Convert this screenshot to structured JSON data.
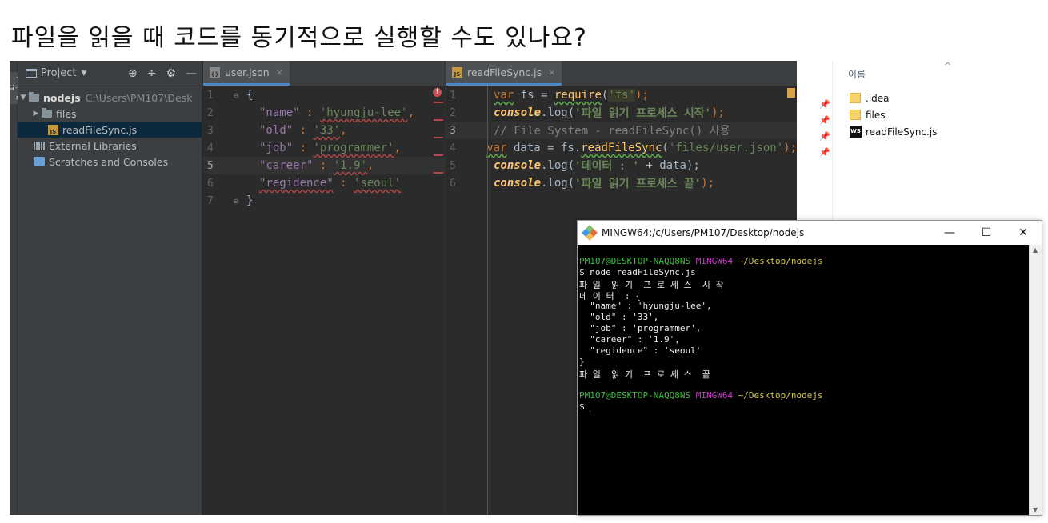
{
  "slide": {
    "title": "파일을 읽을 때 코드를 동기적으로 실행할 수도 있나요?"
  },
  "ide": {
    "stripe_label": "1: Project",
    "project_panel": {
      "header": "Project",
      "tree": [
        {
          "label": "nodejs",
          "path": "C:\\Users\\PM107\\Desk"
        },
        {
          "label": "files"
        },
        {
          "label": "readFileSync.js"
        },
        {
          "label": "External Libraries"
        },
        {
          "label": "Scratches and Consoles"
        }
      ]
    },
    "tabs": {
      "left": "user.json",
      "right": "readFileSync.js",
      "close": "×"
    },
    "json_lines": [
      [
        "1",
        "{"
      ],
      [
        "2",
        "\"name\"",
        " : ",
        "'hyungju-lee'",
        ","
      ],
      [
        "3",
        "\"old\"",
        " : ",
        "'33'",
        ","
      ],
      [
        "4",
        "\"job\"",
        " : ",
        "'programmer'",
        ","
      ],
      [
        "5",
        "\"career\"",
        " : ",
        "'1.9'",
        ","
      ],
      [
        "6",
        "\"regidence\"",
        " : ",
        "'seoul'",
        ""
      ],
      [
        "7",
        "}"
      ]
    ],
    "js_lines": {
      "l1": [
        "1",
        "var",
        " fs = ",
        "require",
        "(",
        "'fs'",
        ");"
      ],
      "l2": [
        "2",
        "console",
        ".log(",
        "'파일 읽기 프로세스 시작'",
        ");"
      ],
      "l3": [
        "3",
        "// File System - readFileSync() 사용"
      ],
      "l4": [
        "4",
        "var",
        " data = fs.",
        "readFileSync",
        "(",
        "'files/user.json'",
        ");"
      ],
      "l5": [
        "5",
        "console",
        ".log(",
        "'데이터 : '",
        " + data);"
      ],
      "l6": [
        "6",
        "console",
        ".log(",
        "'파일 읽기 프로세스 끝'",
        ");"
      ]
    }
  },
  "explorer": {
    "column_header": "이름",
    "items": [
      ".idea",
      "files",
      "readFileSync.js"
    ]
  },
  "terminal": {
    "title": "MINGW64:/c/Users/PM107/Desktop/nodejs",
    "controls": {
      "minimize": "—",
      "maximize": "☐",
      "close": "✕"
    },
    "prompt": {
      "user": "PM107@DESKTOP-NAQQ8NS",
      "env": "MINGW64",
      "dir": "~/Desktop/nodejs"
    },
    "command": "$ node readFileSync.js",
    "output": [
      "파 일  읽 기  프 로 세 스  시 작",
      "데 이 터  : {",
      "  \"name\" : 'hyungju-lee',",
      "  \"old\" : '33',",
      "  \"job\" : 'programmer',",
      "  \"career\" : '1.9',",
      "  \"regidence\" : 'seoul'",
      "}",
      "파 일  읽 기  프 로 세 스  끝"
    ],
    "prompt_symbol": "$ "
  }
}
